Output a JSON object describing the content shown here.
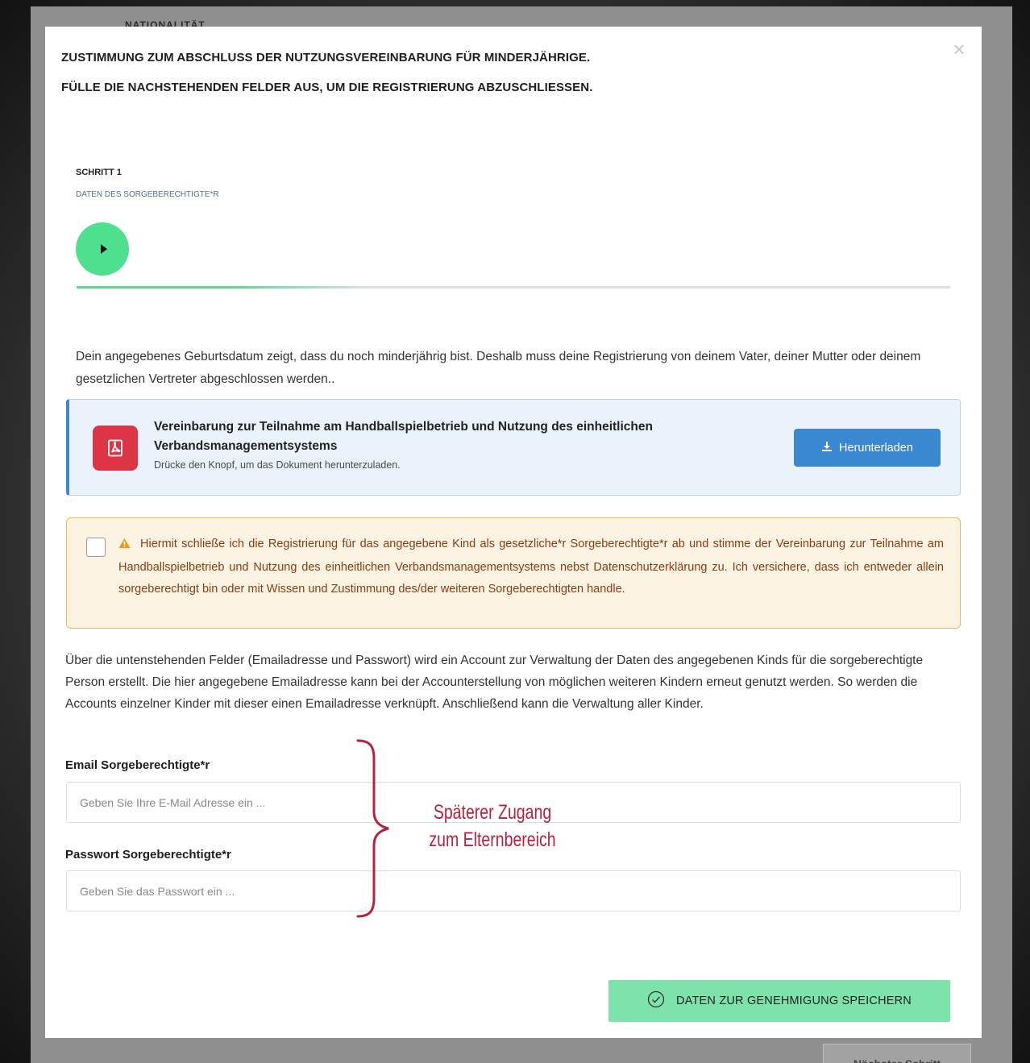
{
  "background_page": {
    "title": "NATIONALITÄT",
    "next_button_label": "Nächster Schritt"
  },
  "modal": {
    "heading_line1": "ZUSTIMMUNG ZUM ABSCHLUSS DER NUTZUNGSVEREINBARUNG FÜR MINDERJÄHRIGE.",
    "heading_line2": "FÜLLE DIE NACHSTEHENDEN FELDER AUS, UM DIE REGISTRIERUNG ABZUSCHLIESSEN.",
    "close_icon": "close-icon",
    "step": {
      "label": "SCHRITT 1",
      "subtitle": "DATEN DES SORGEBERECHTIGTE*R",
      "icon": "play-icon",
      "progress": 0.33
    },
    "intro_text": "Dein angegebenes Geburtsdatum zeigt, dass du noch minderjährig bist. Deshalb muss deine Registrierung von deinem Vater, deiner Mutter oder deinem gesetzlichen Vertreter abgeschlossen werden..",
    "document": {
      "title": "Vereinbarung zur Teilnahme am Handballspielbetrieb und Nutzung des einheitlichen Verbandsmanagementsystems",
      "subtitle": "Drücke den Knopf, um das Dokument herunterzuladen.",
      "icon": "pdf-icon",
      "download_label": "Herunterladen",
      "download_icon": "download-icon"
    },
    "consent": {
      "icon": "warning-icon",
      "text": "Hiermit schließe ich die Registrierung für das angegebene Kind als gesetzliche*r Sorgeberechtigte*r ab und stimme der Vereinbarung zur Teilnahme am Handballspielbetrieb und Nutzung des einheitlichen Verbandsmanagementsystems nebst Datenschutzerklärung zu. Ich versichere, dass ich entweder allein sorgeberechtigt bin oder mit Wissen und Zustimmung des/der weiteren Sorgeberechtigten handle.",
      "checked": false
    },
    "info_text": "Über die untenstehenden Felder (Emailadresse und Passwort) wird ein Account zur Verwaltung der Daten des angegebenen Kinds für die sorgeberechtigte Person erstellt. Die hier angegebene Emailadresse kann bei der Accounterstellung von möglichen weiteren Kindern erneut genutzt werden. So werden die Accounts einzelner Kinder mit dieser einen Emailadresse verknüpft. Anschließend kann die Verwaltung aller Kinder.",
    "email": {
      "label": "Email Sorgeberechtigte*r",
      "placeholder": "Geben Sie Ihre E-Mail Adresse ein ...",
      "value": ""
    },
    "password": {
      "label": "Passwort Sorgeberechtigte*r",
      "placeholder": "Geben Sie das Passwort ein ...",
      "value": ""
    },
    "annotation": {
      "line1": "Späterer Zugang",
      "line2": "zum Elternbereich",
      "color": "#b8233b"
    },
    "save_button": {
      "label": "DATEN ZUR GENEHMIGUNG SPEICHERN",
      "icon": "check-circle-icon"
    }
  },
  "colors": {
    "accent_green": "#4fe08f",
    "button_green": "#7ee2ab",
    "download_blue": "#3b88d2",
    "pdf_red": "#dc3545",
    "warning_border": "#f0b75b",
    "warning_text": "#8a3c12"
  }
}
